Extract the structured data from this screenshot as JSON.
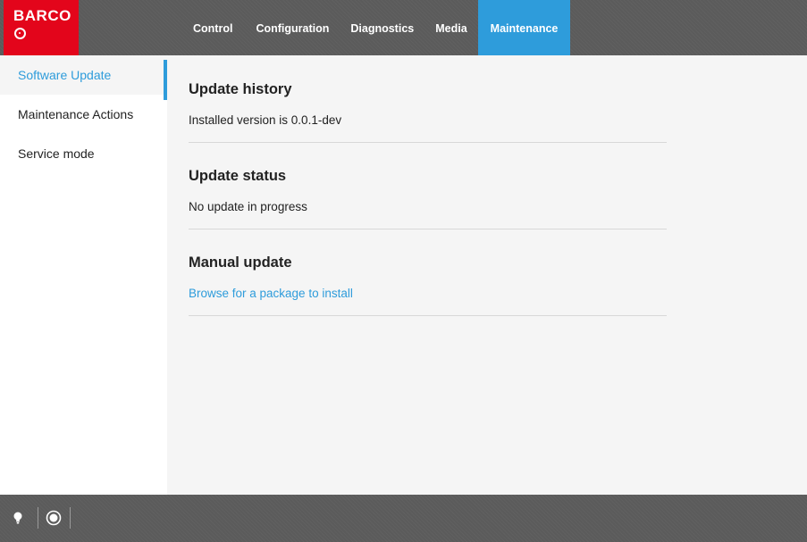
{
  "brand": {
    "name": "BARCO"
  },
  "nav": {
    "tabs": [
      {
        "label": "Control"
      },
      {
        "label": "Configuration"
      },
      {
        "label": "Diagnostics"
      },
      {
        "label": "Media"
      },
      {
        "label": "Maintenance",
        "active": true
      }
    ]
  },
  "sidebar": {
    "items": [
      {
        "label": "Software Update",
        "active": true
      },
      {
        "label": "Maintenance Actions"
      },
      {
        "label": "Service mode"
      }
    ]
  },
  "main": {
    "sections": [
      {
        "title": "Update history",
        "text": "Installed version is 0.0.1-dev"
      },
      {
        "title": "Update status",
        "text": "No update in progress"
      },
      {
        "title": "Manual update",
        "link": "Browse for a package to install"
      }
    ]
  },
  "footer": {
    "icons": [
      "lightbulb-icon",
      "record-icon"
    ]
  },
  "colors": {
    "accent": "#2e9cdb",
    "brand": "#e3051b",
    "bar": "#5b5b5b"
  }
}
